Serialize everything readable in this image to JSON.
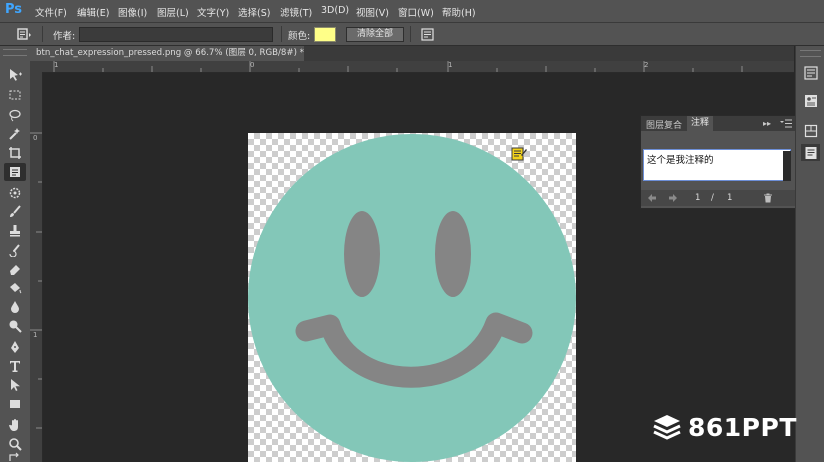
{
  "app": {
    "logo": "Ps"
  },
  "menu": [
    {
      "label": "文件(F)"
    },
    {
      "label": "编辑(E)"
    },
    {
      "label": "图像(I)"
    },
    {
      "label": "图层(L)"
    },
    {
      "label": "文字(Y)"
    },
    {
      "label": "选择(S)"
    },
    {
      "label": "滤镜(T)"
    },
    {
      "label": "3D(D)"
    },
    {
      "label": "视图(V)"
    },
    {
      "label": "窗口(W)"
    },
    {
      "label": "帮助(H)"
    }
  ],
  "options_bar": {
    "author_label": "作者:",
    "author_value": "",
    "color_label": "颜色:",
    "color_value": "#ffff88",
    "clear_all_label": "清除全部"
  },
  "document_tab": {
    "title": "btn_chat_expression_pressed.png @ 66.7% (图层 0, RGB/8#) *",
    "close_glyph": "×"
  },
  "rulers": {
    "top_labels": [
      "1",
      "0",
      "1",
      "2"
    ],
    "left_labels": [
      "0",
      "1"
    ]
  },
  "artwork": {
    "face_color": "#83c7b8",
    "feature_color": "#858585",
    "note_icon_color": "#f2d21b"
  },
  "notes_panel": {
    "tabs": [
      {
        "label": "图层复合",
        "active": false
      },
      {
        "label": "注释",
        "active": true
      }
    ],
    "menu_glyph": "▸▸",
    "note_text": "这个是我注释的",
    "nav": {
      "current": "1",
      "separator": "/",
      "total": "1"
    }
  },
  "watermark": {
    "text": "861PPT"
  }
}
